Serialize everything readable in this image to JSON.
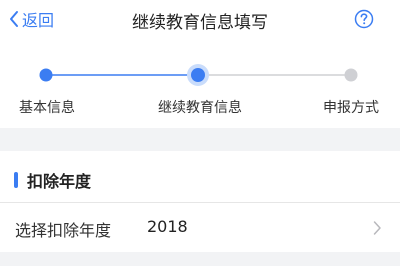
{
  "header": {
    "back_label": "返回",
    "title": "继续教育信息填写",
    "help_icon": "question-circle-icon"
  },
  "steps": [
    {
      "label": "基本信息",
      "state": "done"
    },
    {
      "label": "继续教育信息",
      "state": "current"
    },
    {
      "label": "申报方式",
      "state": "pending"
    }
  ],
  "section": {
    "title": "扣除年度"
  },
  "year_row": {
    "label": "选择扣除年度",
    "value": "2018",
    "icon": "chevron-right-icon"
  },
  "colors": {
    "accent": "#3b7df2",
    "pending": "#cfd0d4",
    "background": "#f2f3f5"
  }
}
